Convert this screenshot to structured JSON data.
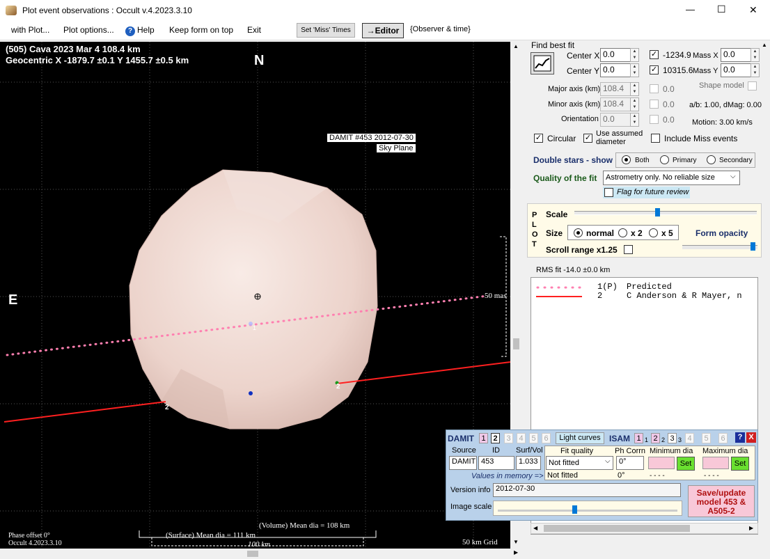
{
  "window": {
    "title": "Plot event observations : Occult v.4.2023.3.10",
    "minimize": "—",
    "maximize": "☐",
    "close": "✕"
  },
  "menu": {
    "with_plot": "with Plot...",
    "plot_options": "Plot options...",
    "help": "Help",
    "keep_on_top": "Keep form on top",
    "exit": "Exit",
    "set_miss": "Set 'Miss' Times",
    "editor": "→Editor",
    "observer_time": "{Observer & time}"
  },
  "plot": {
    "asteroid_line": "(505) Cava  2023 Mar 4   108.4 km",
    "geocentric_line": "Geocentric  X  -1879.7 ±0.1  Y  1455.7 ±0.5 km",
    "north": "N",
    "east": "E",
    "damit_label1": "DAMIT #453 2012-07-30",
    "damit_label2": "Sky Plane",
    "scale_mark": "50 mas",
    "chord_num1": "2",
    "chord_num2": "2",
    "center_num": "1",
    "phase_offset": "Phase offset 0°",
    "version": "Occult 4.2023.3.10",
    "volume_dia": "(Volume) Mean dia = 108 km",
    "surface_dia": "(Surface) Mean dia = 111 km",
    "scale_100": "100 km",
    "grid": "50 km Grid"
  },
  "fit": {
    "find_best_fit": "Find best fit",
    "center_x_label": "Center X",
    "center_x": "0.0",
    "center_y_label": "Center Y",
    "center_y": "0.0",
    "val_x": "-1234.9",
    "val_y": "10315.6",
    "mass_x_label": "Mass X",
    "mass_x": "0.0",
    "mass_y_label": "Mass Y",
    "mass_y": "0.0",
    "major_label": "Major axis (km)",
    "major": "108.4",
    "minor_label": "Minor axis (km)",
    "minor": "108.4",
    "orient_label": "Orientation",
    "orient": "0.0",
    "zero1": "0.0",
    "zero2": "0.0",
    "zero3": "0.0",
    "shape_model": "Shape model",
    "ab_dmag": "a/b: 1.00, dMag: 0.00",
    "motion": "Motion: 3.00 km/s",
    "circular": "Circular",
    "use_assumed": "Use assumed diameter",
    "include_miss": "Include Miss events",
    "double_stars": "Double stars - show",
    "both": "Both",
    "primary": "Primary",
    "secondary": "Secondary",
    "quality_label": "Quality of the fit",
    "quality_value": "Astrometry only. No reliable size",
    "flag_review": "Flag for future review"
  },
  "plotpanel": {
    "p": "P",
    "l": "L",
    "o": "O",
    "t": "T",
    "scale": "Scale",
    "size": "Size",
    "normal": "normal",
    "x2": "x 2",
    "x5": "x 5",
    "form_opacity": "Form opacity",
    "scroll_range": "Scroll range x1.25"
  },
  "rms": "RMS fit -14.0 ±0.0 km",
  "legend": [
    {
      "num": "1(P)",
      "name": "Predicted"
    },
    {
      "num": "2",
      "name": "C Anderson & R Mayer, n"
    }
  ],
  "damit": {
    "title": "DAMIT",
    "tabs": [
      "1",
      "2",
      "3",
      "4",
      "5",
      "6"
    ],
    "light_curves": "Light curves",
    "isam": "ISAM",
    "isam_tabs": [
      "1",
      "1",
      "2",
      "2",
      "3",
      "3",
      "4",
      "5",
      "6"
    ],
    "help": "?",
    "close": "X",
    "source_label": "Source",
    "id_label": "ID",
    "surf_label": "Surf/Vol",
    "source": "DAMIT",
    "id": "453",
    "surf": "1.033",
    "values_mem": "Values in memory =>",
    "fit_quality_label": "Fit quality",
    "fit_quality": "Not fitted",
    "fit_quality2": "Not fitted",
    "ph_corr_label": "Ph Corrn",
    "ph_corr": "0°",
    "ph_corr2": "0°",
    "min_dia_label": "Minimum dia",
    "max_dia_label": "Maximum dia",
    "set": "Set",
    "dashes": "- - - -",
    "version_label": "Version info",
    "version": "2012-07-30",
    "image_scale": "Image scale",
    "save": "Save/update model 453 & A505-2"
  }
}
